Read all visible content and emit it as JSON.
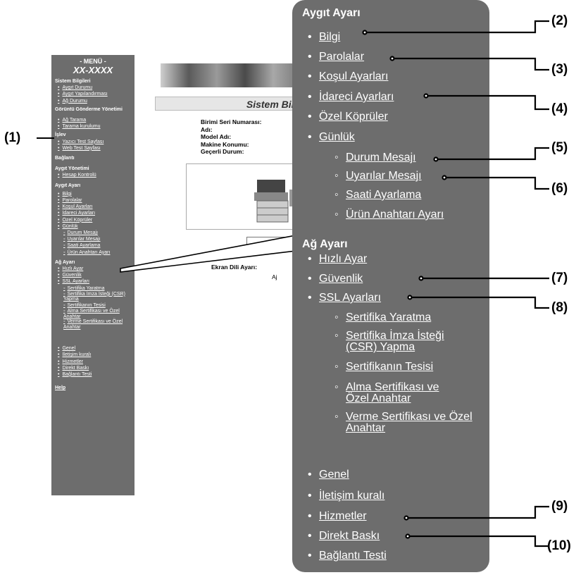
{
  "small_menu": {
    "header": "- MENÜ -",
    "model": "XX-XXXX",
    "sections": [
      {
        "title": "Sistem Bilgileri",
        "items": [
          "Aygıt Durumu",
          "Aygıt Yapılandırması",
          "Ağ Durumu"
        ]
      },
      {
        "title": "Görüntü Gönderme Yönetimi",
        "items": [
          "Ağ Tarama",
          "Tarama kurulumu"
        ]
      },
      {
        "title": "İşlev",
        "items": [
          "Yazıcı Test Sayfası",
          "Web Test Sayfası"
        ]
      },
      {
        "title": "Bağlantı",
        "items": []
      },
      {
        "title": "Aygıt Yönetimi",
        "items": [
          "Hesap Kontrolü"
        ]
      },
      {
        "title": "Aygıt Ayarı",
        "items": [
          "Bilgi",
          "Parolalar",
          "Koşul Ayarları",
          "İdareci Ayarları",
          "Özel Köprüler",
          "Günlük"
        ],
        "subitems": [
          "Durum Mesajı",
          "Uyarılar Mesajı",
          "Saati Ayarlama",
          "Ürün Anahtarı Ayarı"
        ]
      },
      {
        "title": "Ağ Ayarı",
        "items": [
          "Hızlı Ayar",
          "Güvenlik",
          "SSL Ayarları"
        ],
        "subitems": [
          "Sertifika Yaratma",
          "Sertifika İmza İsteği (CSR) Yapma",
          "Sertifikanın Tesisi",
          "Alma Sertifikası ve Özel Anahtar",
          "Verme Sertifikası ve Özel Anahtar"
        ]
      }
    ],
    "bottom_items": [
      "Genel",
      "İletişim kuralı",
      "Hizmetler",
      "Direkt Baskı",
      "Bağlantı Testi"
    ],
    "help": "Help"
  },
  "page": {
    "title": "Sistem Bilgi",
    "fields": [
      "Birimi Seri Numarası:",
      "Adı:",
      "Model Adı:",
      "Makine Konumu:",
      "Geçerli Durum:"
    ],
    "language_label": "Ekran Dili Ayarı:",
    "aj": "Aj"
  },
  "big_menu": {
    "aygit_title": "Aygıt Ayarı",
    "aygit_items": [
      "Bilgi",
      "Parolalar",
      "Koşul Ayarları",
      "İdareci Ayarları",
      "Özel Köprüler",
      "Günlük"
    ],
    "gunluk_sub": [
      "Durum Mesajı",
      "Uyarılar Mesajı",
      "Saati Ayarlama",
      "Ürün Anahtarı Ayarı"
    ],
    "ag_title": "Ağ Ayarı",
    "ag_items": [
      "Hızlı Ayar",
      "Güvenlik",
      "SSL Ayarları"
    ],
    "ssl_sub": [
      "Sertifika Yaratma",
      "Sertifika İmza İsteği (CSR) Yapma",
      "Sertifikanın Tesisi",
      "Alma Sertifikası ve Özel Anahtar",
      "Verme Sertifikası ve Özel Anahtar"
    ],
    "bottom_items": [
      "Genel",
      "İletişim kuralı",
      "Hizmetler",
      "Direkt Baskı",
      "Bağlantı Testi"
    ]
  },
  "callouts": [
    "(1)",
    "(2)",
    "(3)",
    "(4)",
    "(5)",
    "(6)",
    "(7)",
    "(8)",
    "(9)",
    "(10)"
  ],
  "colors": {
    "panel": "#6d6d6d",
    "text": "#ffffff"
  }
}
